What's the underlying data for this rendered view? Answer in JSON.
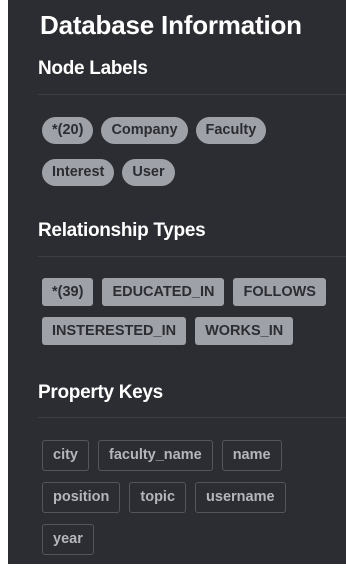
{
  "panel": {
    "title": "Database Information"
  },
  "node_labels": {
    "title": "Node Labels",
    "items": [
      "*(20)",
      "Company",
      "Faculty",
      "Interest",
      "User"
    ]
  },
  "relationship_types": {
    "title": "Relationship Types",
    "items": [
      "*(39)",
      "EDUCATED_IN",
      "FOLLOWS",
      "INSTERESTED_IN",
      "WORKS_IN"
    ]
  },
  "property_keys": {
    "title": "Property Keys",
    "items": [
      "city",
      "faculty_name",
      "name",
      "position",
      "topic",
      "username",
      "year"
    ]
  },
  "colors": {
    "panel_background": "#2c2d32",
    "chip_background": "#9fa1a8",
    "key_border": "#55565d"
  }
}
